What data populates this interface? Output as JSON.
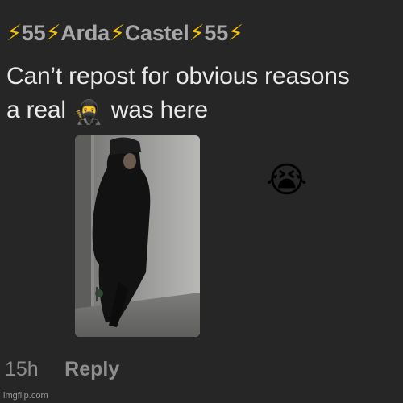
{
  "comment": {
    "username": "⚡55⚡Arda⚡Castel⚡55⚡",
    "text_line1": "Can’t repost for obvious reasons",
    "text_line2_before": "a real",
    "inline_emoji": "🥷",
    "text_line2_after": "was here",
    "reaction_emoji": "😭",
    "timestamp": "15h",
    "reply_label": "Reply"
  },
  "watermark": "imgflip.com",
  "colors": {
    "background": "#262627",
    "username": "#a8a8a8",
    "text": "#e9e9e9",
    "muted": "#8d8d8d"
  }
}
